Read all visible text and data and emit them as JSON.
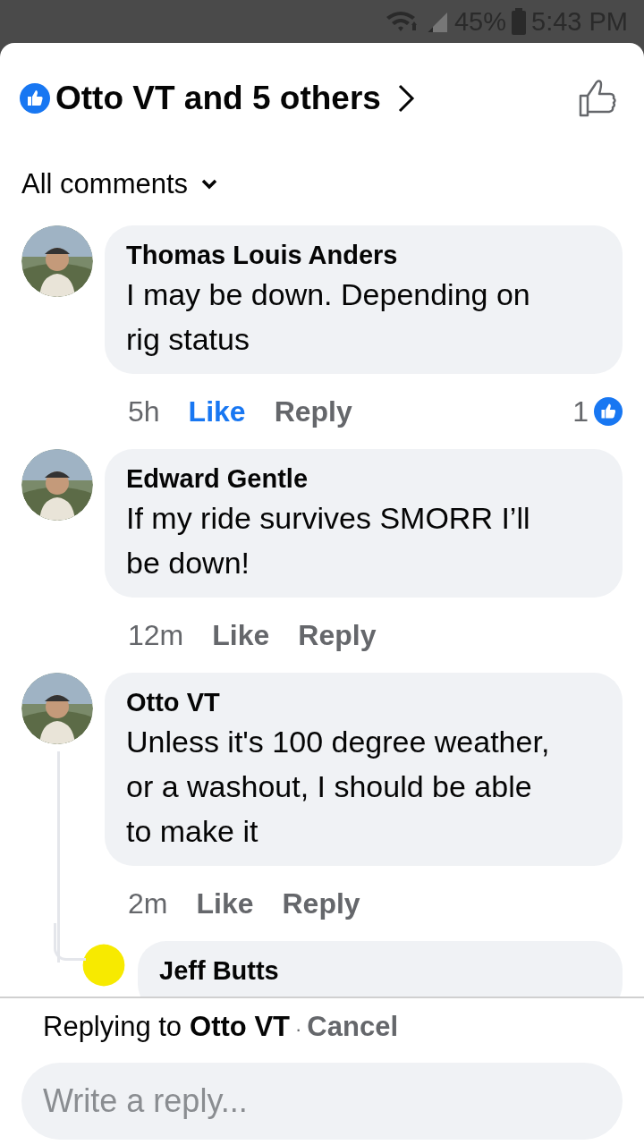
{
  "status_bar": {
    "battery": "45%",
    "time": "5:43 PM"
  },
  "header": {
    "reactions_label": "Otto VT and 5 others"
  },
  "filter": {
    "label": "All comments"
  },
  "comments": [
    {
      "author": "Thomas Louis Anders",
      "text": "I may be down. Depending on rig status",
      "time": "5h",
      "like": "Like",
      "reply": "Reply",
      "liked": true,
      "reaction_count": "1"
    },
    {
      "author": "Edward Gentle",
      "text": "If my ride survives SMORR I’ll be down!",
      "time": "12m",
      "like": "Like",
      "reply": "Reply",
      "liked": false
    },
    {
      "author": "Otto VT",
      "text": "Unless it's 100 degree weather, or a washout, I should be able to make it",
      "time": "2m",
      "like": "Like",
      "reply": "Reply",
      "liked": false,
      "children": [
        {
          "author": "Jeff Butts",
          "avatar": {
            "kind": "plain",
            "color": "#f7ea00"
          }
        }
      ]
    }
  ],
  "composer": {
    "replying_prefix": "Replying to",
    "replying_name": "Otto VT",
    "separator": "·",
    "cancel": "Cancel",
    "placeholder": "Write a reply..."
  }
}
